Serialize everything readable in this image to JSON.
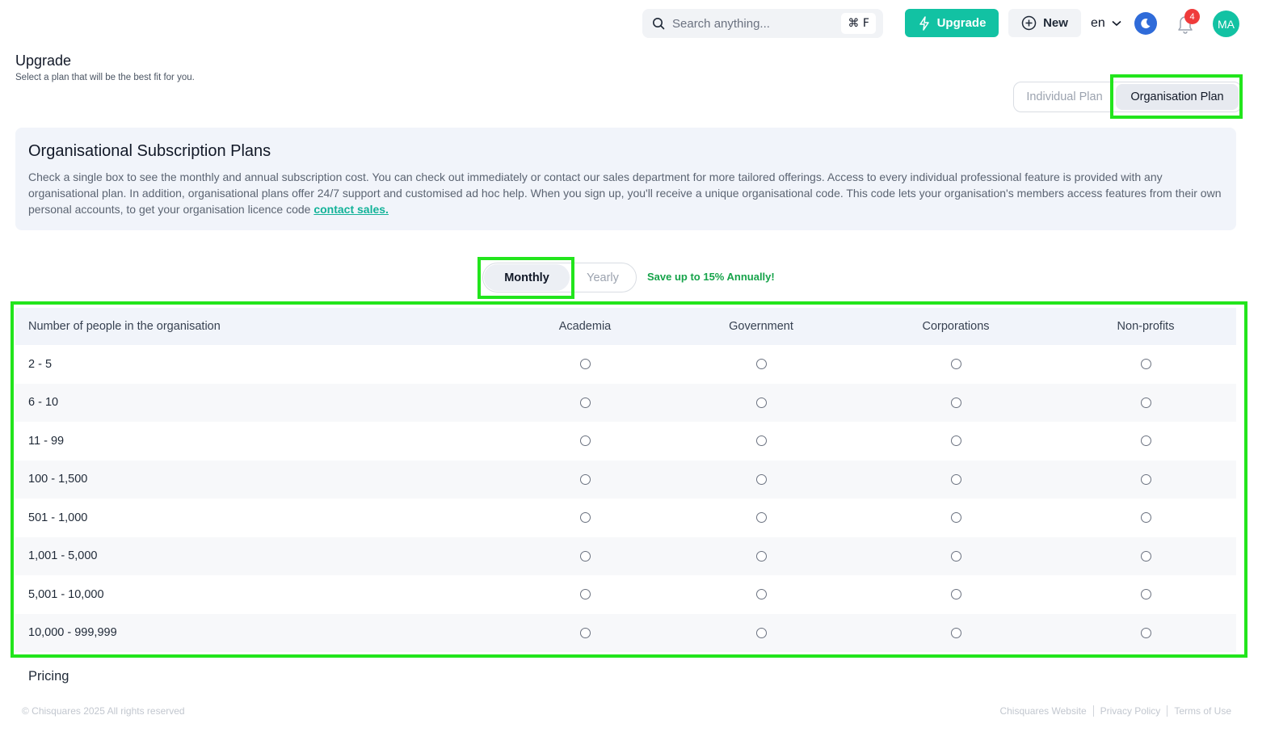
{
  "header": {
    "search_placeholder": "Search anything...",
    "search_shortcut": "⌘ F",
    "upgrade_label": "Upgrade",
    "new_label": "New",
    "language": "en",
    "notification_count": "4",
    "avatar_initials": "MA"
  },
  "page": {
    "title": "Upgrade",
    "subtitle": "Select a plan that will be the best fit for you."
  },
  "plan_toggle": {
    "individual_label": "Individual Plan",
    "organisation_label": "Organisation Plan",
    "selected": "Organisation Plan"
  },
  "info": {
    "title": "Organisational Subscription Plans",
    "body": "Check a single box to see the monthly and annual subscription cost. You can check out immediately or contact our sales department for more tailored offerings. Access to every individual professional feature is provided with any organisational plan. In addition, organisational plans offer 24/7 support and customised ad hoc help. When you sign up, you'll receive a unique organisational code. This code lets your organisation's members access features from their own personal accounts, to get your organisation licence code ",
    "link_label": "contact sales."
  },
  "billing": {
    "monthly_label": "Monthly",
    "yearly_label": "Yearly",
    "selected": "Monthly",
    "save_note": "Save up to 15% Annually!"
  },
  "table": {
    "columns": [
      "Number of people in the organisation",
      "Academia",
      "Government",
      "Corporations",
      "Non-profits"
    ],
    "rows": [
      "2 - 5",
      "6 - 10",
      "11 - 99",
      "100 - 1,500",
      "501 - 1,000",
      "1,001 - 5,000",
      "5,001 - 10,000",
      "10,000 - 999,999"
    ]
  },
  "pricing_label": "Pricing",
  "footer": {
    "copyright": "© Chisquares 2025 All rights reserved",
    "links": [
      "Chisquares Website",
      "Privacy Policy",
      "Terms of Use"
    ]
  },
  "colors": {
    "accent": "#12c2a3",
    "highlight": "#22e51c",
    "save_note": "#16a34a",
    "badge": "#ef3b3b"
  }
}
